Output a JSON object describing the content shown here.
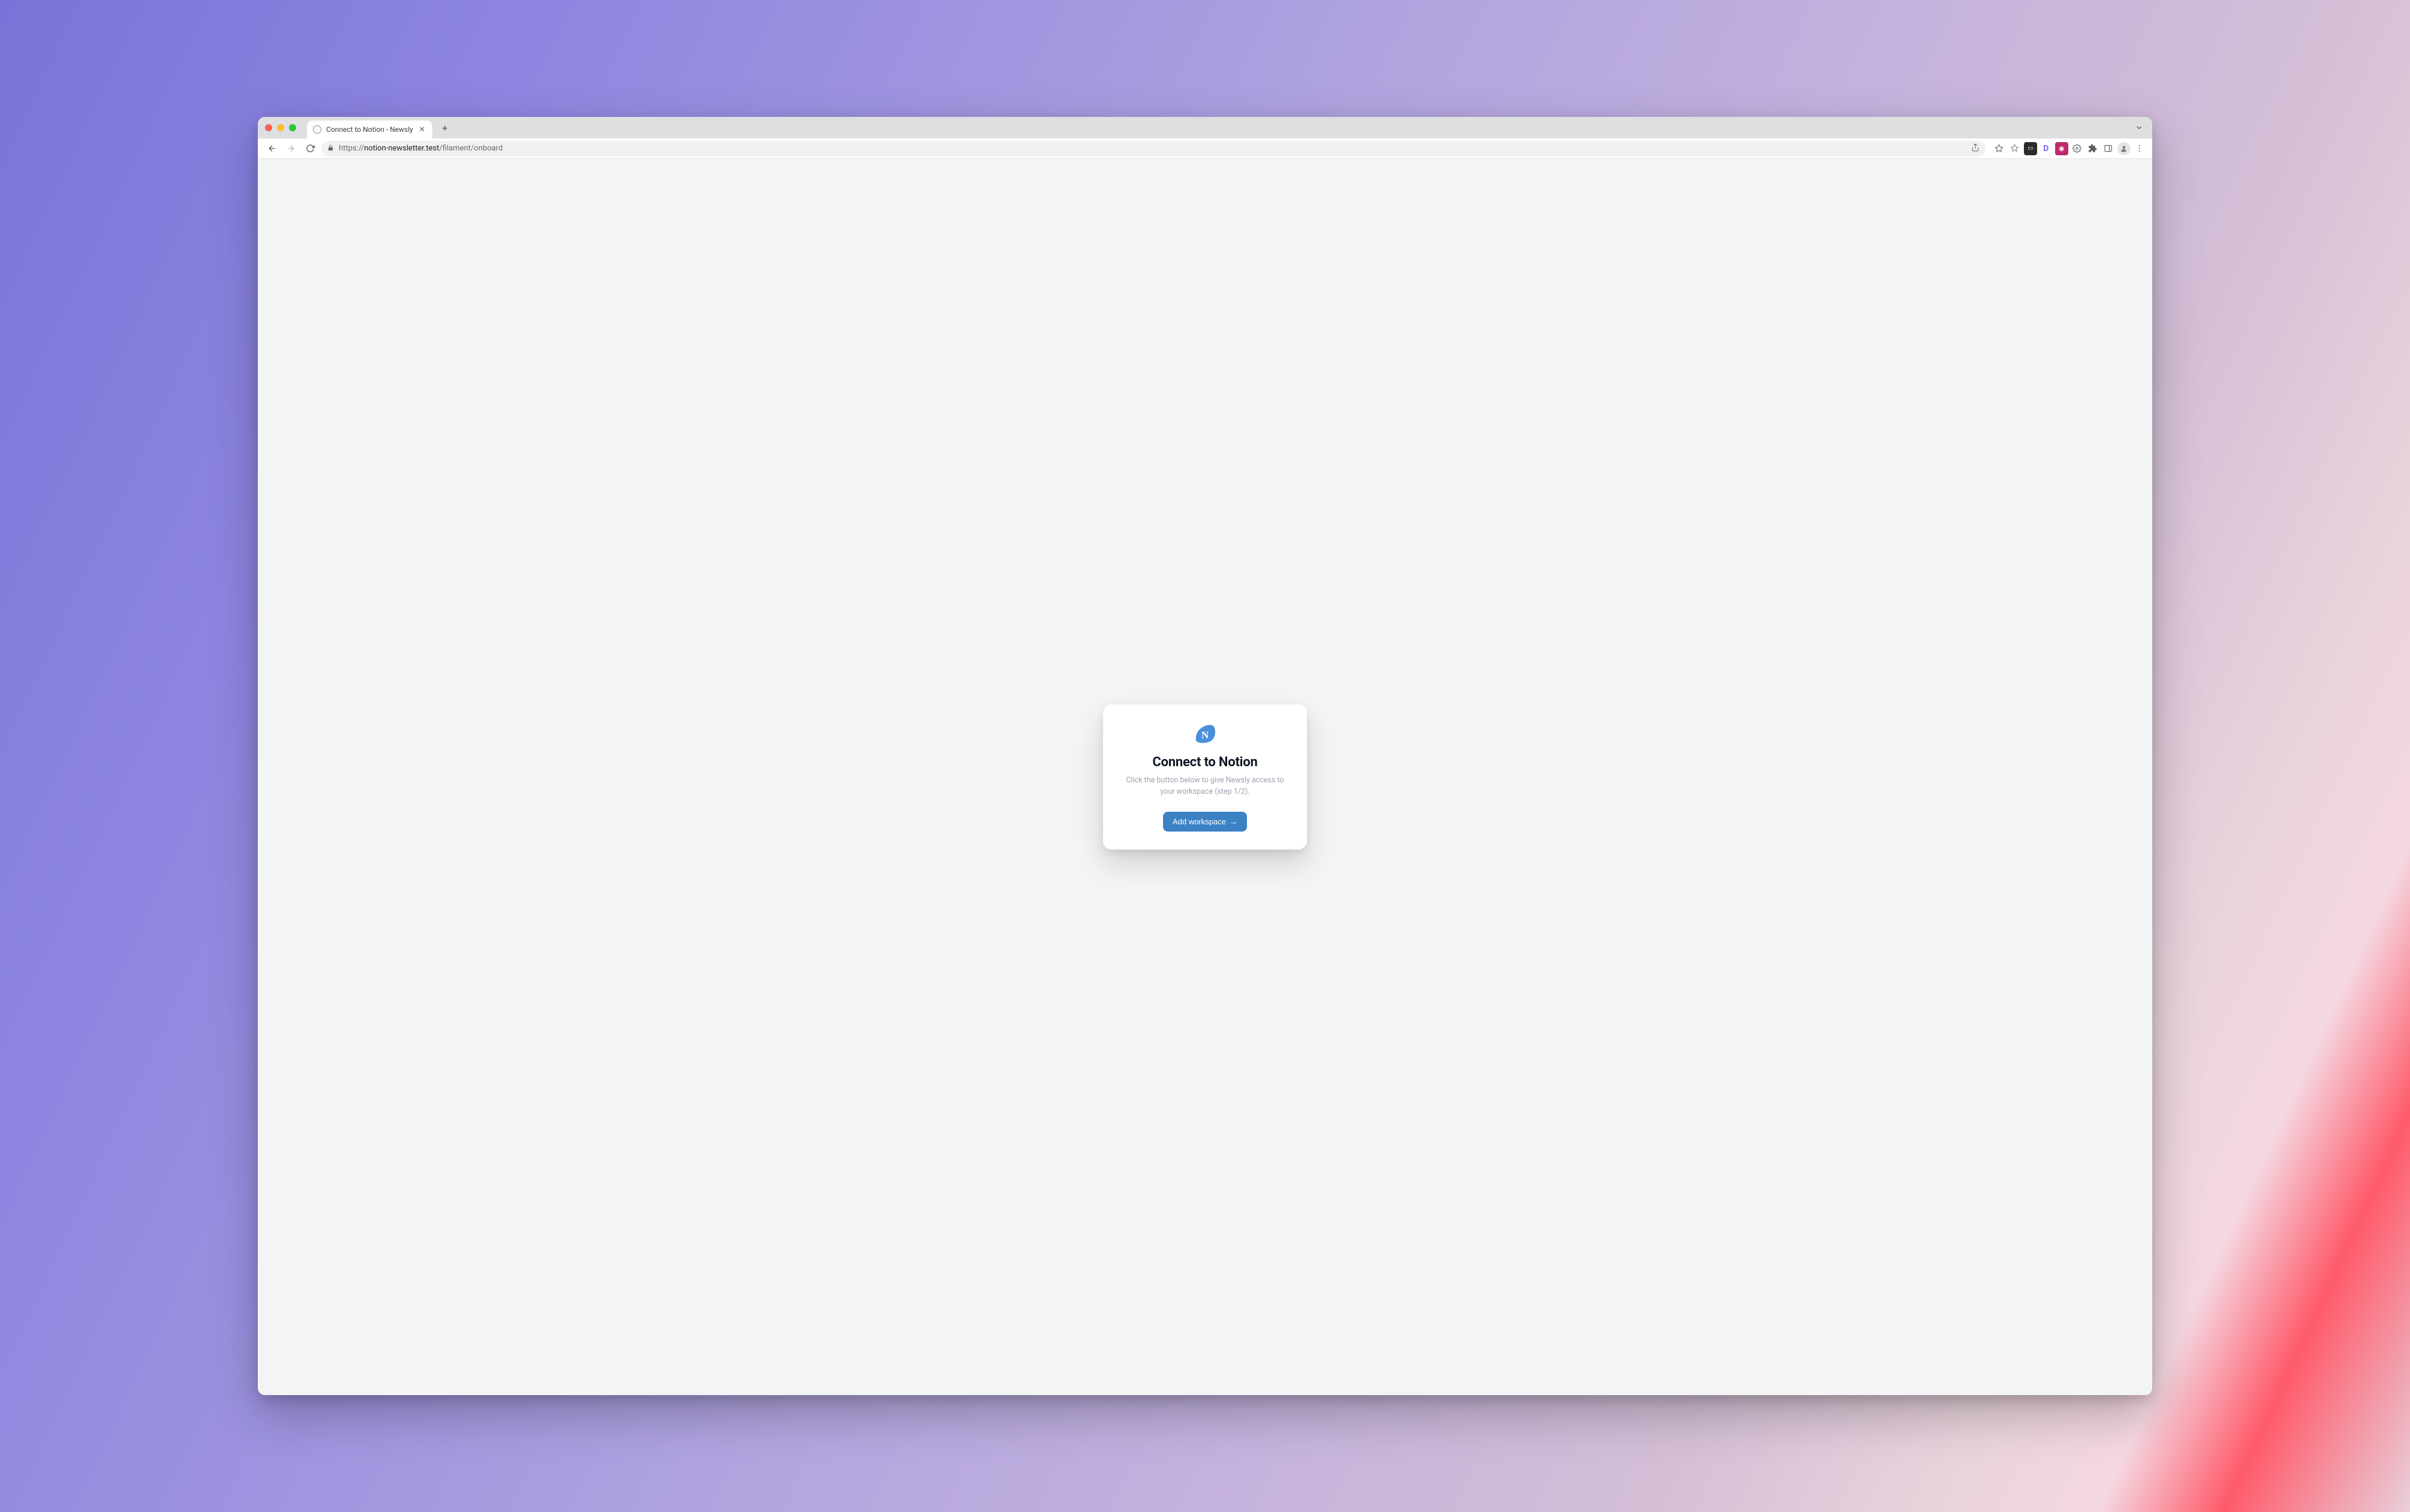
{
  "browser": {
    "tab_title": "Connect to Notion - Newsly",
    "url_scheme": "https://",
    "url_host": "notion-newsletter.test",
    "url_path": "/filament/onboard"
  },
  "card": {
    "heading": "Connect to Notion",
    "subtext": "Click the button below to give Newsly access to your workspace (step 1/2).",
    "button_label": "Add workspace",
    "button_arrow": "→",
    "logo_letter": "N"
  },
  "colors": {
    "primary_button": "#3b82c4",
    "card_bg": "#ffffff",
    "viewport_bg": "#f3f4f6"
  }
}
